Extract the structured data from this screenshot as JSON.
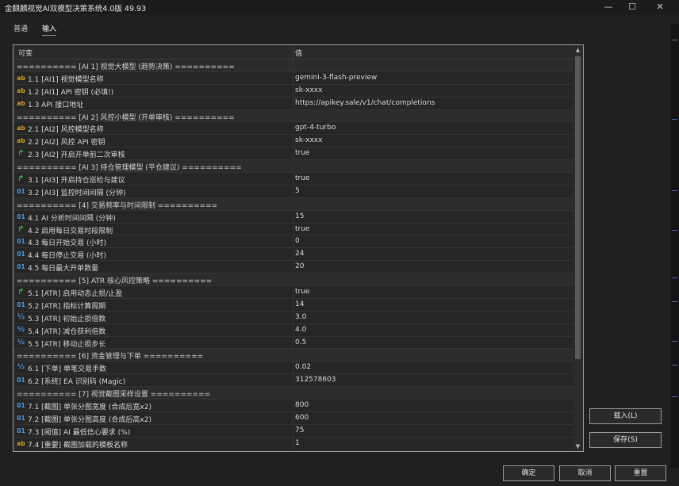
{
  "window": {
    "title": "金麒麟视觉AI双模型决策系统4.0版 49.93",
    "minimize": "—",
    "maximize": "☐",
    "close": "✕"
  },
  "tabs": [
    {
      "label": "普通",
      "active": false
    },
    {
      "label": "输入",
      "active": true
    }
  ],
  "table": {
    "col_variable": "可变",
    "col_value": "值",
    "rows": [
      {
        "type": "section",
        "name": "========== [AI 1] 视觉大模型 (趋势决策) =========="
      },
      {
        "type": "ab",
        "name": "1.1 [AI1] 视觉模型名称",
        "value": "gemini-3-flash-preview"
      },
      {
        "type": "ab",
        "name": "1.2 [AI1] API 密钥 (必填!)",
        "value": "sk-xxxx"
      },
      {
        "type": "ab",
        "name": "1.3 API 接口地址",
        "value": "https://apikey.sale/v1/chat/completions"
      },
      {
        "type": "section",
        "name": "========== [AI 2] 风控小模型 (开单审核) =========="
      },
      {
        "type": "ab",
        "name": "2.1 [AI2] 风控模型名称",
        "value": "gpt-4-turbo"
      },
      {
        "type": "ab",
        "name": "2.2 [AI2] 风控 API 密钥",
        "value": "sk-xxxx"
      },
      {
        "type": "bool",
        "name": "2.3 [AI2] 开启开单前二次审核",
        "value": "true"
      },
      {
        "type": "section",
        "name": "========== [AI 3] 持仓管理模型 (平仓建议) =========="
      },
      {
        "type": "bool",
        "name": "3.1 [AI3] 开启持仓巡检与建议",
        "value": "true"
      },
      {
        "type": "n01",
        "name": "3.2 [AI3] 监控时间间隔 (分钟)",
        "value": "5"
      },
      {
        "type": "section",
        "name": "========== [4] 交易频率与时间限制 =========="
      },
      {
        "type": "n01",
        "name": "4.1 AI 分析时间间隔 (分钟)",
        "value": "15"
      },
      {
        "type": "bool",
        "name": "4.2 启用每日交易时段限制",
        "value": "true"
      },
      {
        "type": "n01",
        "name": "4.3 每日开始交易 (小时)",
        "value": "0"
      },
      {
        "type": "n01",
        "name": "4.4 每日停止交易 (小时)",
        "value": "24"
      },
      {
        "type": "n01",
        "name": "4.5 每日最大开单数量",
        "value": "20"
      },
      {
        "type": "section",
        "name": "========== [5] ATR 核心风控策略 =========="
      },
      {
        "type": "bool",
        "name": "5.1 [ATR] 启用动态止损/止盈",
        "value": "true"
      },
      {
        "type": "n01",
        "name": "5.2 [ATR] 指标计算周期",
        "value": "14"
      },
      {
        "type": "half",
        "name": "5.3 [ATR] 初始止损倍数",
        "value": "3.0"
      },
      {
        "type": "half",
        "name": "5.4 [ATR] 减仓获利倍数",
        "value": "4.0"
      },
      {
        "type": "half",
        "name": "5.5 [ATR] 移动止损步长",
        "value": "0.5"
      },
      {
        "type": "section",
        "name": "========== [6] 资金管理与下单 =========="
      },
      {
        "type": "half",
        "name": "6.1 [下单] 单笔交易手数",
        "value": "0.02"
      },
      {
        "type": "n01",
        "name": "6.2 [系统] EA 识别码 (Magic)",
        "value": "312578603"
      },
      {
        "type": "section",
        "name": "========== [7] 视觉截图采样设置 =========="
      },
      {
        "type": "n01",
        "name": "7.1 [截图] 单张分图宽度 (合成后宽x2)",
        "value": "800"
      },
      {
        "type": "n01",
        "name": "7.2 [截图] 单张分图高度 (合成后高x2)",
        "value": "600"
      },
      {
        "type": "n01",
        "name": "7.3 [阈值] AI 最低信心要求 (%)",
        "value": "75"
      },
      {
        "type": "ab",
        "name": "7.4 [重要] 截图加载的模板名称",
        "value": "1"
      }
    ]
  },
  "icons": {
    "ab": "ab",
    "n01": "01",
    "half": "½",
    "bool": "↱"
  },
  "buttons": {
    "load": "载入(L)",
    "save": "保存(S)",
    "ok": "确定",
    "cancel": "取消",
    "reset": "重置"
  }
}
